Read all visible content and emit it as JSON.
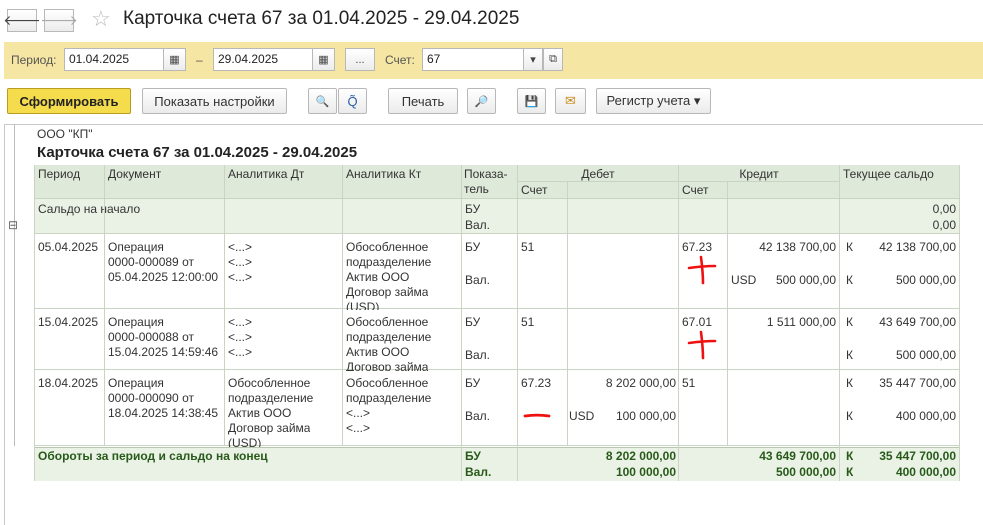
{
  "window": {
    "title": "Карточка счета 67 за 01.04.2025 - 29.04.2025",
    "back_glyph": "🡐",
    "forward_glyph": "🡒",
    "star_glyph": "☆"
  },
  "filter": {
    "period_label": "Период:",
    "date_from": "01.04.2025",
    "dash": "–",
    "date_to": "29.04.2025",
    "dots": "...",
    "account_label": "Счет:",
    "account": "67",
    "calendar_glyph": "▦",
    "dropdown_glyph": "▾",
    "open_glyph": "⧉"
  },
  "toolbar": {
    "generate": "Сформировать",
    "settings": "Показать настройки",
    "print": "Печать",
    "register": "Регистр учета ▾",
    "search_glyph": "🔍",
    "search_reset_glyph": "Q̃",
    "preview_glyph": "🔎",
    "save_glyph": "💾",
    "mail_glyph": "✉"
  },
  "report": {
    "org": "ООО \"КП\"",
    "title": "Карточка счета 67 за 01.04.2025 - 29.04.2025",
    "headers": {
      "period": "Период",
      "document": "Документ",
      "an_dt": "Аналитика Дт",
      "an_kt": "Аналитика Кт",
      "indicator1": "Показа-",
      "indicator2": "тель",
      "debit": "Дебет",
      "credit": "Кредит",
      "debit_acc": "Счет",
      "credit_acc": "Счет",
      "balance": "Текущее сальдо"
    },
    "opening": {
      "label": "Сальдо на начало",
      "ind1": "БУ",
      "ind2": "Вал.",
      "bal1": "0,00",
      "bal2": "0,00"
    },
    "collapse_glyph": "⊟",
    "rows": [
      {
        "period": "05.04.2025",
        "doc1": "Операция",
        "doc2": "0000-000089 от",
        "doc3": "05.04.2025 12:00:00",
        "dt1": "<...>",
        "dt2": "<...>",
        "dt3": "<...>",
        "dt4": "",
        "dt5": "",
        "kt1": "Обособленное",
        "kt2": "подразделение",
        "kt3": "Актив ООО",
        "kt4": "Договор займа",
        "kt5": "(USD)",
        "ind1": "БУ",
        "ind2": "Вал.",
        "debit_acc": "51",
        "debit_sum": "",
        "debit_cur": "",
        "debit_cur_sum": "",
        "credit_acc": "67.23",
        "credit_sum": "42 138 700,00",
        "credit_cur": "USD",
        "credit_cur_sum": "500 000,00",
        "bal_side1": "К",
        "bal1": "42 138 700,00",
        "bal_side2": "К",
        "bal2": "500 000,00",
        "mark": "plus"
      },
      {
        "period": "15.04.2025",
        "doc1": "Операция",
        "doc2": "0000-000088 от",
        "doc3": "15.04.2025 14:59:46",
        "dt1": "<...>",
        "dt2": "<...>",
        "dt3": "<...>",
        "dt4": "",
        "dt5": "",
        "kt1": "Обособленное",
        "kt2": "подразделение",
        "kt3": "Актив ООО",
        "kt4": "Договор займа",
        "kt5": "",
        "ind1": "БУ",
        "ind2": "Вал.",
        "debit_acc": "51",
        "debit_sum": "",
        "debit_cur": "",
        "debit_cur_sum": "",
        "credit_acc": "67.01",
        "credit_sum": "1 511 000,00",
        "credit_cur": "",
        "credit_cur_sum": "",
        "bal_side1": "К",
        "bal1": "43 649 700,00",
        "bal_side2": "К",
        "bal2": "500 000,00",
        "mark": "plus"
      },
      {
        "period": "18.04.2025",
        "doc1": "Операция",
        "doc2": "0000-000090 от",
        "doc3": "18.04.2025 14:38:45",
        "dt1": "Обособленное",
        "dt2": "подразделение",
        "dt3": "Актив ООО",
        "dt4": "Договор займа",
        "dt5": "(USD)",
        "kt1": "Обособленное",
        "kt2": "подразделение",
        "kt3": "<...>",
        "kt4": "<...>",
        "kt5": "",
        "ind1": "БУ",
        "ind2": "Вал.",
        "debit_acc": "67.23",
        "debit_sum": "8 202 000,00",
        "debit_cur": "USD",
        "debit_cur_sum": "100 000,00",
        "credit_acc": "51",
        "credit_sum": "",
        "credit_cur": "",
        "credit_cur_sum": "",
        "bal_side1": "К",
        "bal1": "35 447 700,00",
        "bal_side2": "К",
        "bal2": "400 000,00",
        "mark": "minus"
      }
    ],
    "totals": {
      "label": "Обороты за период и сальдо на конец",
      "ind1": "БУ",
      "ind2": "Вал.",
      "debit1": "8 202 000,00",
      "debit2": "100 000,00",
      "credit1": "43 649 700,00",
      "credit2": "500 000,00",
      "side1": "К",
      "side2": "К",
      "bal1": "35 447 700,00",
      "bal2": "400 000,00"
    }
  }
}
